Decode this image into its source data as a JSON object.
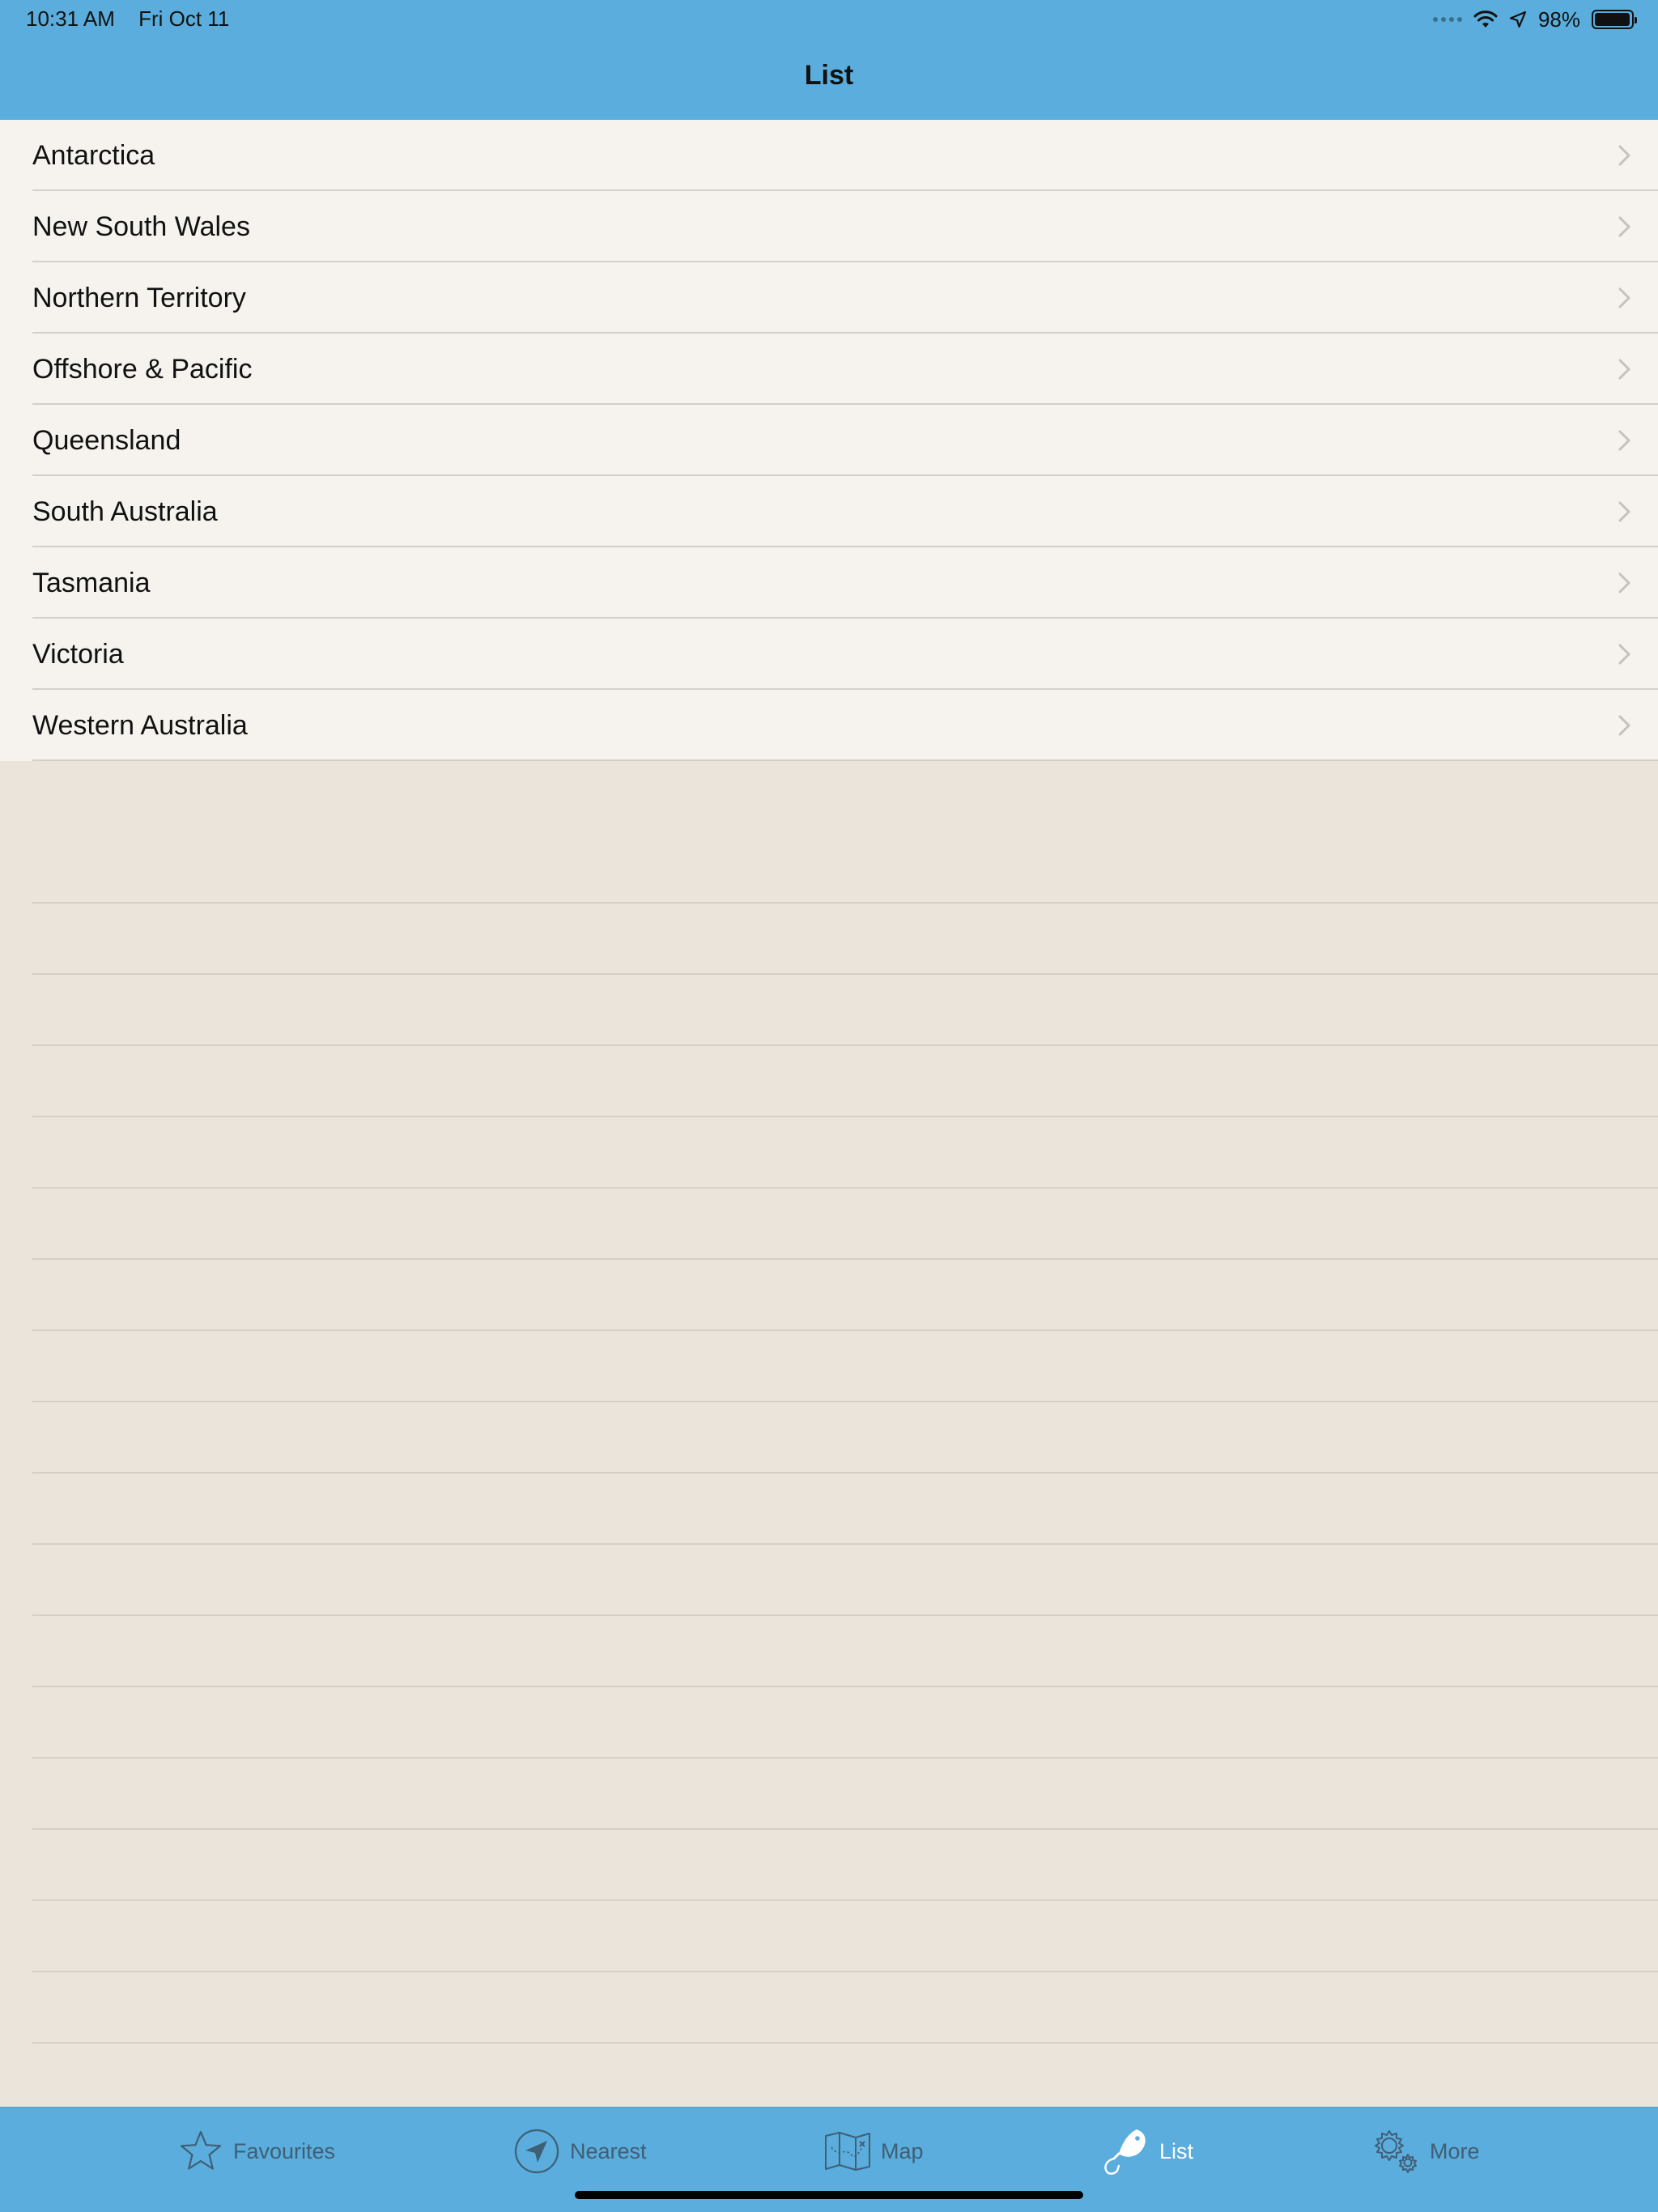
{
  "status_bar": {
    "time": "10:31 AM",
    "date": "Fri Oct 11",
    "battery": "98%",
    "battery_level": 0.98
  },
  "nav": {
    "title": "List"
  },
  "list": {
    "items": [
      {
        "label": "Antarctica"
      },
      {
        "label": "New South Wales"
      },
      {
        "label": "Northern Territory"
      },
      {
        "label": "Offshore & Pacific"
      },
      {
        "label": "Queensland"
      },
      {
        "label": "South Australia"
      },
      {
        "label": "Tasmania"
      },
      {
        "label": "Victoria"
      },
      {
        "label": "Western Australia"
      }
    ]
  },
  "tabbar": {
    "tabs": [
      {
        "label": "Favourites",
        "icon": "star-icon",
        "active": false
      },
      {
        "label": "Nearest",
        "icon": "location-arrow-icon",
        "active": false
      },
      {
        "label": "Map",
        "icon": "map-icon",
        "active": false
      },
      {
        "label": "List",
        "icon": "fish-hook-icon",
        "active": true
      },
      {
        "label": "More",
        "icon": "gear-icon",
        "active": false
      }
    ]
  },
  "colors": {
    "bar": "#5aaddc",
    "list_bg": "#f6f3ee",
    "page_bg": "#ebe4db",
    "tab_inactive": "#3f5f75",
    "tab_active": "#ffffff"
  }
}
